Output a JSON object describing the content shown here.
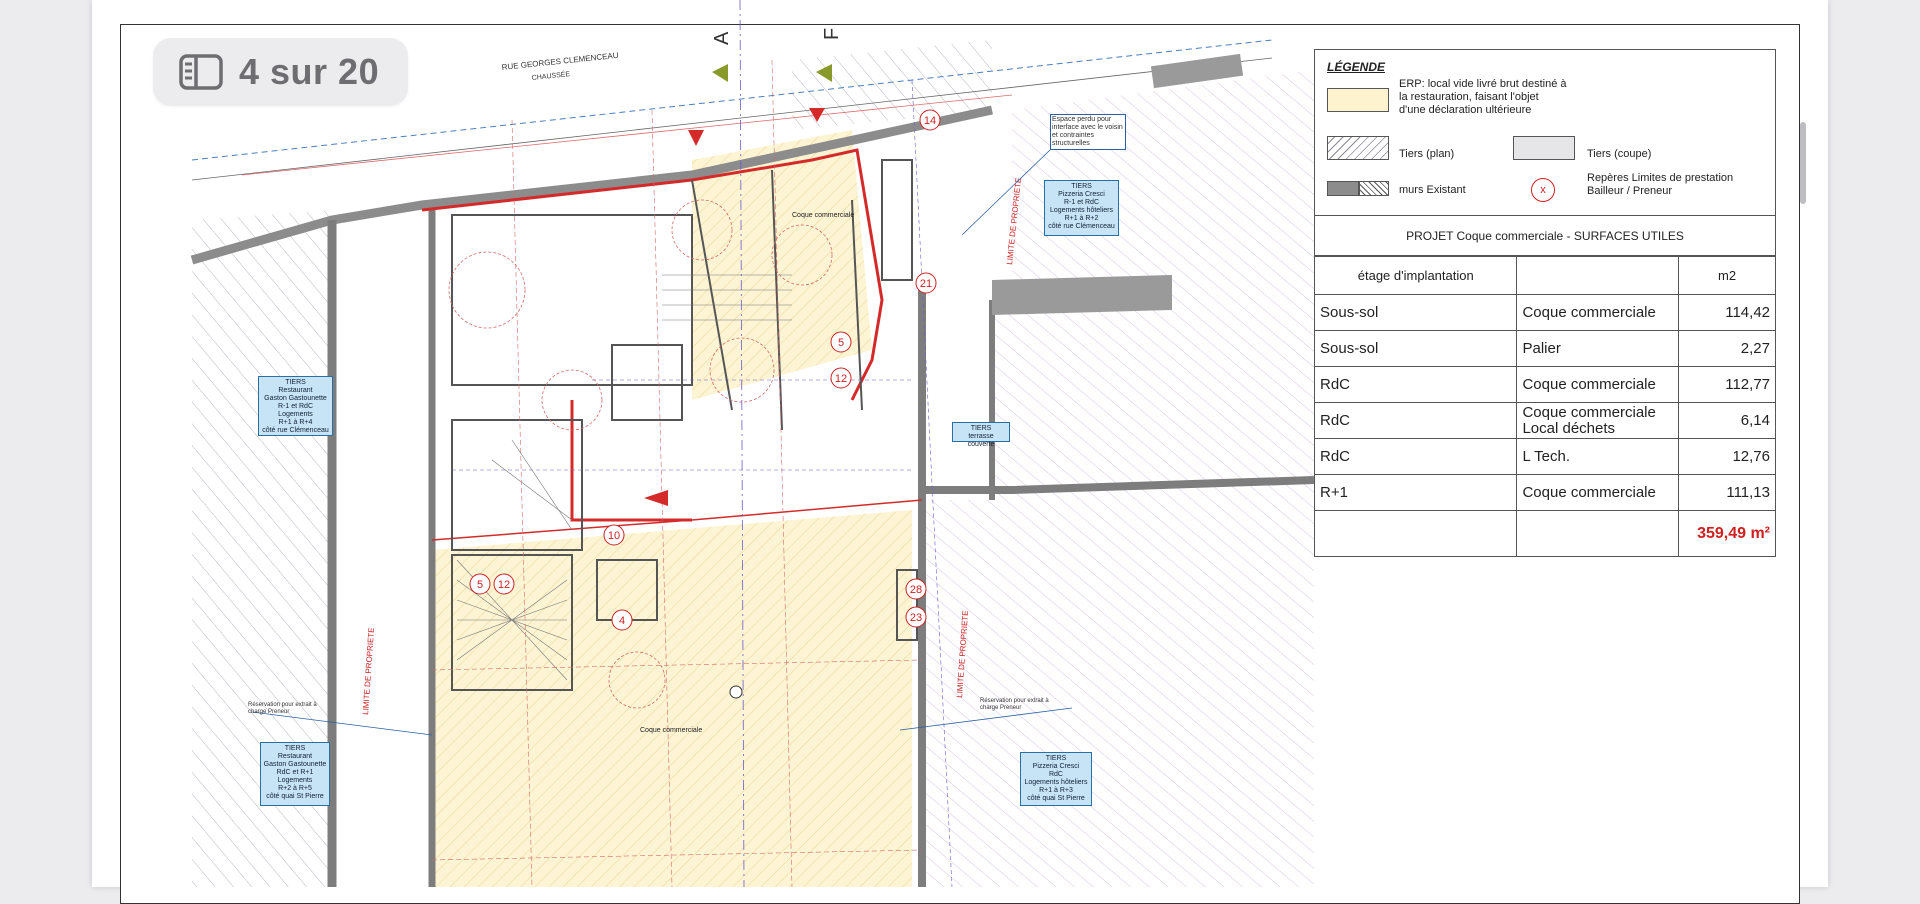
{
  "viewer": {
    "page_counter": "4 sur 20"
  },
  "plan": {
    "street_name": "RUE GEORGES CLEMENCEAU",
    "street_sub": "CHAUSSÉE",
    "axis_a": "A",
    "axis_f": "F",
    "limit_label": "LIMITE DE PROPRIETE",
    "space_note": "Espace perdu pour interface avec le voisin et contraintes structurelles",
    "coque_label": "Coque commerciale",
    "reservation_note": "Réservation pour extrait à charge Preneur",
    "numbers": [
      "14",
      "21",
      "5",
      "12",
      "10",
      "5",
      "12",
      "4",
      "28",
      "23"
    ],
    "tags": {
      "pizzeria_top": "TIERS\nPizzeria Cresci\nR-1 et RdC\nLogements hôteliers\nR+1 à R+2\ncôté rue Clémenceau",
      "gaston_top": "TIERS\nRestaurant\nGaston Gastounette\nR-1 et RdC\nLogements\nR+1 à R+4\ncôté rue Clémenceau",
      "terrasse": "TIERS\nterrasse couverte",
      "gaston_bottom": "TIERS\nRestaurant\nGaston Gastounette\nRdC et R+1\nLogements\nR+2 à R+5\ncôté quai St Pierre",
      "pizzeria_bottom": "TIERS\nPizzeria Cresci\nRdC\nLogements hôteliers\nR+1 à R+3\ncôté quai St Pierre"
    }
  },
  "legend": {
    "title": "LÉGENDE",
    "erp": "ERP: local vide livré brut destiné à\nla restauration, faisant l'objet\nd'une déclaration ultérieure",
    "tiers_plan": "Tiers (plan)",
    "tiers_coupe": "Tiers (coupe)",
    "murs": "murs Existant",
    "reperes": "Repères Limites de prestation\nBailleur / Preneur",
    "reperes_symbol": "x"
  },
  "surfaces": {
    "title": "PROJET Coque commerciale - SURFACES UTILES",
    "headers": [
      "étage d'implantation",
      "",
      "m2"
    ],
    "rows": [
      {
        "etage": "Sous-sol",
        "usage": "Coque commerciale",
        "m2": "114,42"
      },
      {
        "etage": "Sous-sol",
        "usage": "Palier",
        "m2": "2,27"
      },
      {
        "etage": "RdC",
        "usage": "Coque commerciale",
        "m2": "112,77"
      },
      {
        "etage": "RdC",
        "usage": "Coque commerciale\nLocal déchets",
        "m2": "6,14"
      },
      {
        "etage": "RdC",
        "usage": "L Tech.",
        "m2": "12,76"
      },
      {
        "etage": "R+1",
        "usage": "Coque commerciale",
        "m2": "111,13"
      }
    ],
    "total": "359,49 m²"
  },
  "colors": {
    "erp_fill": "#fdf3cf",
    "hatch": "#9a9aa8",
    "wall": "#8c8c8c",
    "red_line": "#d42a2a",
    "tag_fill": "#c6e4f6"
  }
}
